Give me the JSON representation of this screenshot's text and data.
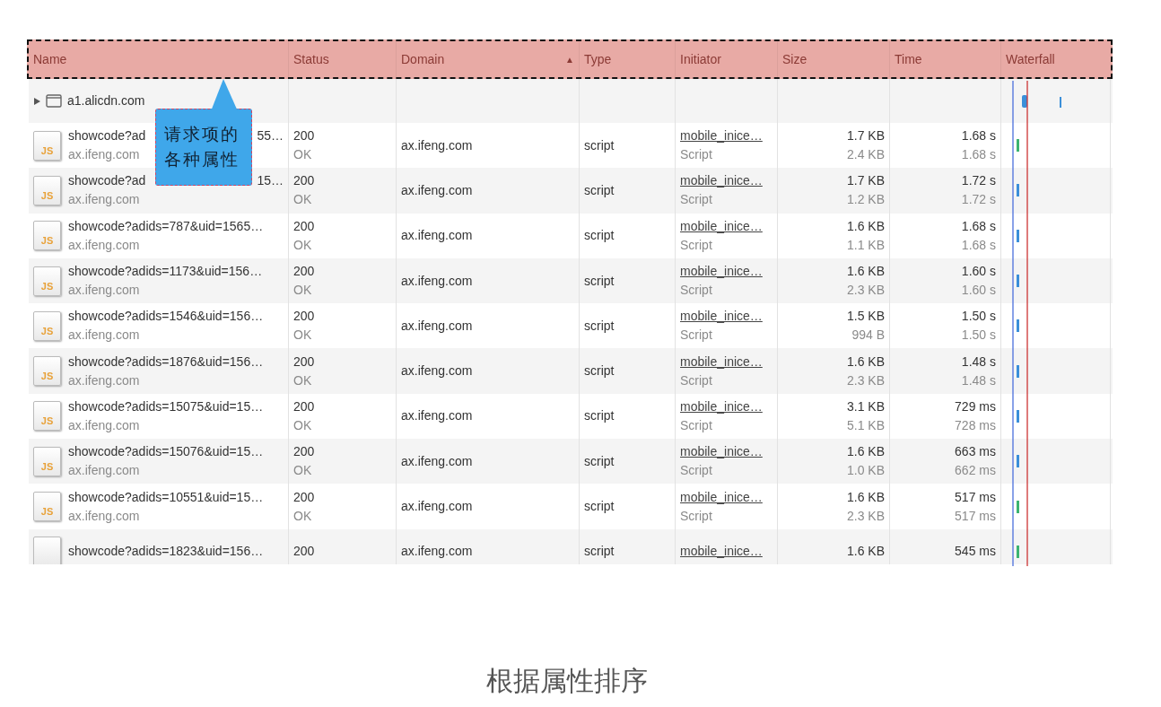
{
  "table": {
    "columns": [
      {
        "label": "Name"
      },
      {
        "label": "Status"
      },
      {
        "label": "Domain",
        "sort_indicator": "▲"
      },
      {
        "label": "Type"
      },
      {
        "label": "Initiator"
      },
      {
        "label": "Size"
      },
      {
        "label": "Time"
      },
      {
        "label": "Waterfall"
      }
    ],
    "group": {
      "label": "a1.alicdn.com",
      "expanded": false
    },
    "rows": [
      {
        "icon_text": "JS",
        "name": "showcode?ad",
        "name_tail": "55…",
        "host": "ax.ifeng.com",
        "status": "200",
        "status_text": "OK",
        "domain": "ax.ifeng.com",
        "type": "script",
        "initiator": "mobile_inice…",
        "initiator_type": "Script",
        "size": "1.7 KB",
        "size_2": "2.4 KB",
        "time": "1.68 s",
        "time_2": "1.68 s",
        "color": "#3cb371"
      },
      {
        "icon_text": "JS",
        "name": "showcode?ad",
        "name_tail": "15…",
        "host": "ax.ifeng.com",
        "status": "200",
        "status_text": "OK",
        "domain": "ax.ifeng.com",
        "type": "script",
        "initiator": "mobile_inice…",
        "initiator_type": "Script",
        "size": "1.7 KB",
        "size_2": "1.2 KB",
        "time": "1.72 s",
        "time_2": "1.72 s",
        "color": "#3b8fd9"
      },
      {
        "icon_text": "JS",
        "name": "showcode?adids=787&uid=1565…",
        "host": "ax.ifeng.com",
        "status": "200",
        "status_text": "OK",
        "domain": "ax.ifeng.com",
        "type": "script",
        "initiator": "mobile_inice…",
        "initiator_type": "Script",
        "size": "1.6 KB",
        "size_2": "1.1 KB",
        "time": "1.68 s",
        "time_2": "1.68 s",
        "color": "#3b8fd9"
      },
      {
        "icon_text": "JS",
        "name": "showcode?adids=1173&uid=156…",
        "host": "ax.ifeng.com",
        "status": "200",
        "status_text": "OK",
        "domain": "ax.ifeng.com",
        "type": "script",
        "initiator": "mobile_inice…",
        "initiator_type": "Script",
        "size": "1.6 KB",
        "size_2": "2.3 KB",
        "time": "1.60 s",
        "time_2": "1.60 s",
        "color": "#3b8fd9"
      },
      {
        "icon_text": "JS",
        "name": "showcode?adids=1546&uid=156…",
        "host": "ax.ifeng.com",
        "status": "200",
        "status_text": "OK",
        "domain": "ax.ifeng.com",
        "type": "script",
        "initiator": "mobile_inice…",
        "initiator_type": "Script",
        "size": "1.5 KB",
        "size_2": "994 B",
        "time": "1.50 s",
        "time_2": "1.50 s",
        "color": "#3b8fd9"
      },
      {
        "icon_text": "JS",
        "name": "showcode?adids=1876&uid=156…",
        "host": "ax.ifeng.com",
        "status": "200",
        "status_text": "OK",
        "domain": "ax.ifeng.com",
        "type": "script",
        "initiator": "mobile_inice…",
        "initiator_type": "Script",
        "size": "1.6 KB",
        "size_2": "2.3 KB",
        "time": "1.48 s",
        "time_2": "1.48 s",
        "color": "#3b8fd9"
      },
      {
        "icon_text": "JS",
        "name": "showcode?adids=15075&uid=15…",
        "host": "ax.ifeng.com",
        "status": "200",
        "status_text": "OK",
        "domain": "ax.ifeng.com",
        "type": "script",
        "initiator": "mobile_inice…",
        "initiator_type": "Script",
        "size": "3.1 KB",
        "size_2": "5.1 KB",
        "time": "729 ms",
        "time_2": "728 ms",
        "color": "#3b8fd9"
      },
      {
        "icon_text": "JS",
        "name": "showcode?adids=15076&uid=15…",
        "host": "ax.ifeng.com",
        "status": "200",
        "status_text": "OK",
        "domain": "ax.ifeng.com",
        "type": "script",
        "initiator": "mobile_inice…",
        "initiator_type": "Script",
        "size": "1.6 KB",
        "size_2": "1.0 KB",
        "time": "663 ms",
        "time_2": "662 ms",
        "color": "#3b8fd9"
      },
      {
        "icon_text": "JS",
        "name": "showcode?adids=10551&uid=15…",
        "host": "ax.ifeng.com",
        "status": "200",
        "status_text": "OK",
        "domain": "ax.ifeng.com",
        "type": "script",
        "initiator": "mobile_inice…",
        "initiator_type": "Script",
        "size": "1.6 KB",
        "size_2": "2.3 KB",
        "time": "517 ms",
        "time_2": "517 ms",
        "color": "#3cb371"
      },
      {
        "name": "showcode?adids=1823&uid=156…",
        "status": "200",
        "domain": "ax.ifeng.com",
        "type": "script",
        "initiator": "mobile_inice…",
        "size": "1.6 KB",
        "time": "545 ms",
        "color": "#3cb371"
      }
    ]
  },
  "callout": {
    "text": "请求项的各种属性"
  },
  "caption": "根据属性排序"
}
